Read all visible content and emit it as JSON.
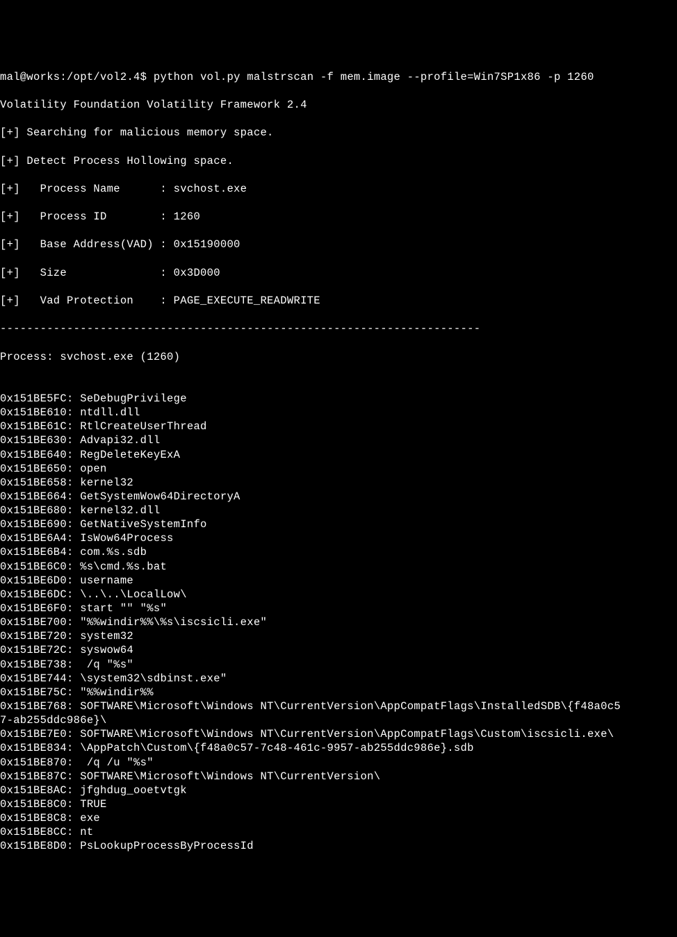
{
  "prompt": {
    "user_host": "mal@works",
    "path": "/opt/vol2.4",
    "symbol": "$",
    "command": "python vol.py malstrscan -f mem.image --profile=Win7SP1x86 -p 1260"
  },
  "header": {
    "banner": "Volatility Foundation Volatility Framework 2.4",
    "search_msg": "[+] Searching for malicious memory space.",
    "detect_msg": "[+] Detect Process Hollowing space.",
    "process_name_label": "[+]   Process Name      : ",
    "process_name_value": "svchost.exe",
    "process_id_label": "[+]   Process ID        : ",
    "process_id_value": "1260",
    "base_addr_label": "[+]   Base Address(VAD) : ",
    "base_addr_value": "0x15190000",
    "size_label": "[+]   Size              : ",
    "size_value": "0x3D000",
    "vad_prot_label": "[+]   Vad Protection    : ",
    "vad_prot_value": "PAGE_EXECUTE_READWRITE"
  },
  "divider": "------------------------------------------------------------------------",
  "process_line": "Process: svchost.exe (1260)",
  "blank": "",
  "strings": [
    {
      "addr": "0x151BE5FC:",
      "val": " SeDebugPrivilege"
    },
    {
      "addr": "0x151BE610:",
      "val": " ntdll.dll"
    },
    {
      "addr": "0x151BE61C:",
      "val": " RtlCreateUserThread"
    },
    {
      "addr": "0x151BE630:",
      "val": " Advapi32.dll"
    },
    {
      "addr": "0x151BE640:",
      "val": " RegDeleteKeyExA"
    },
    {
      "addr": "0x151BE650:",
      "val": " open"
    },
    {
      "addr": "0x151BE658:",
      "val": " kernel32"
    },
    {
      "addr": "0x151BE664:",
      "val": " GetSystemWow64DirectoryA"
    },
    {
      "addr": "0x151BE680:",
      "val": " kernel32.dll"
    },
    {
      "addr": "0x151BE690:",
      "val": " GetNativeSystemInfo"
    },
    {
      "addr": "0x151BE6A4:",
      "val": " IsWow64Process"
    },
    {
      "addr": "0x151BE6B4:",
      "val": " com.%s.sdb"
    },
    {
      "addr": "0x151BE6C0:",
      "val": " %s\\cmd.%s.bat"
    },
    {
      "addr": "0x151BE6D0:",
      "val": " username"
    },
    {
      "addr": "0x151BE6DC:",
      "val": " \\..\\..\\LocalLow\\"
    },
    {
      "addr": "0x151BE6F0:",
      "val": " start \"\" \"%s\""
    },
    {
      "addr": "0x151BE700:",
      "val": " \"%%windir%%\\%s\\iscsicli.exe\""
    },
    {
      "addr": "0x151BE720:",
      "val": " system32"
    },
    {
      "addr": "0x151BE72C:",
      "val": " syswow64"
    },
    {
      "addr": "0x151BE738:",
      "val": "  /q \"%s\""
    },
    {
      "addr": "0x151BE744:",
      "val": " \\system32\\sdbinst.exe\""
    },
    {
      "addr": "0x151BE75C:",
      "val": " \"%%windir%%"
    },
    {
      "addr": "0x151BE768:",
      "val": " SOFTWARE\\Microsoft\\Windows NT\\CurrentVersion\\AppCompatFlags\\InstalledSDB\\{f48a0c5"
    },
    {
      "addr": "",
      "val": "7-ab255ddc986e}\\"
    },
    {
      "addr": "0x151BE7E0:",
      "val": " SOFTWARE\\Microsoft\\Windows NT\\CurrentVersion\\AppCompatFlags\\Custom\\iscsicli.exe\\"
    },
    {
      "addr": "0x151BE834:",
      "val": " \\AppPatch\\Custom\\{f48a0c57-7c48-461c-9957-ab255ddc986e}.sdb"
    },
    {
      "addr": "0x151BE870:",
      "val": "  /q /u \"%s\""
    },
    {
      "addr": "0x151BE87C:",
      "val": " SOFTWARE\\Microsoft\\Windows NT\\CurrentVersion\\"
    },
    {
      "addr": "0x151BE8AC:",
      "val": " jfghdug_ooetvtgk"
    },
    {
      "addr": "0x151BE8C0:",
      "val": " TRUE"
    },
    {
      "addr": "0x151BE8C8:",
      "val": " exe"
    },
    {
      "addr": "0x151BE8CC:",
      "val": " nt"
    },
    {
      "addr": "0x151BE8D0:",
      "val": " PsLookupProcessByProcessId"
    }
  ]
}
